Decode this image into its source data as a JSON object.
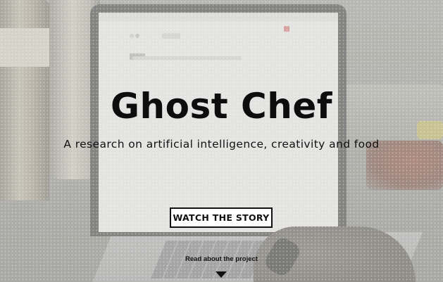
{
  "hero": {
    "title": "Ghost Chef",
    "subtitle": "A research on artificial intelligence, creativity and food",
    "cta_label": "WATCH THE STORY",
    "read_more_label": "Read about the project"
  },
  "icons": {
    "scroll": "chevron-down-icon"
  },
  "colors": {
    "text": "#111111",
    "button_bg": "#ffffff",
    "button_border": "#111111"
  }
}
